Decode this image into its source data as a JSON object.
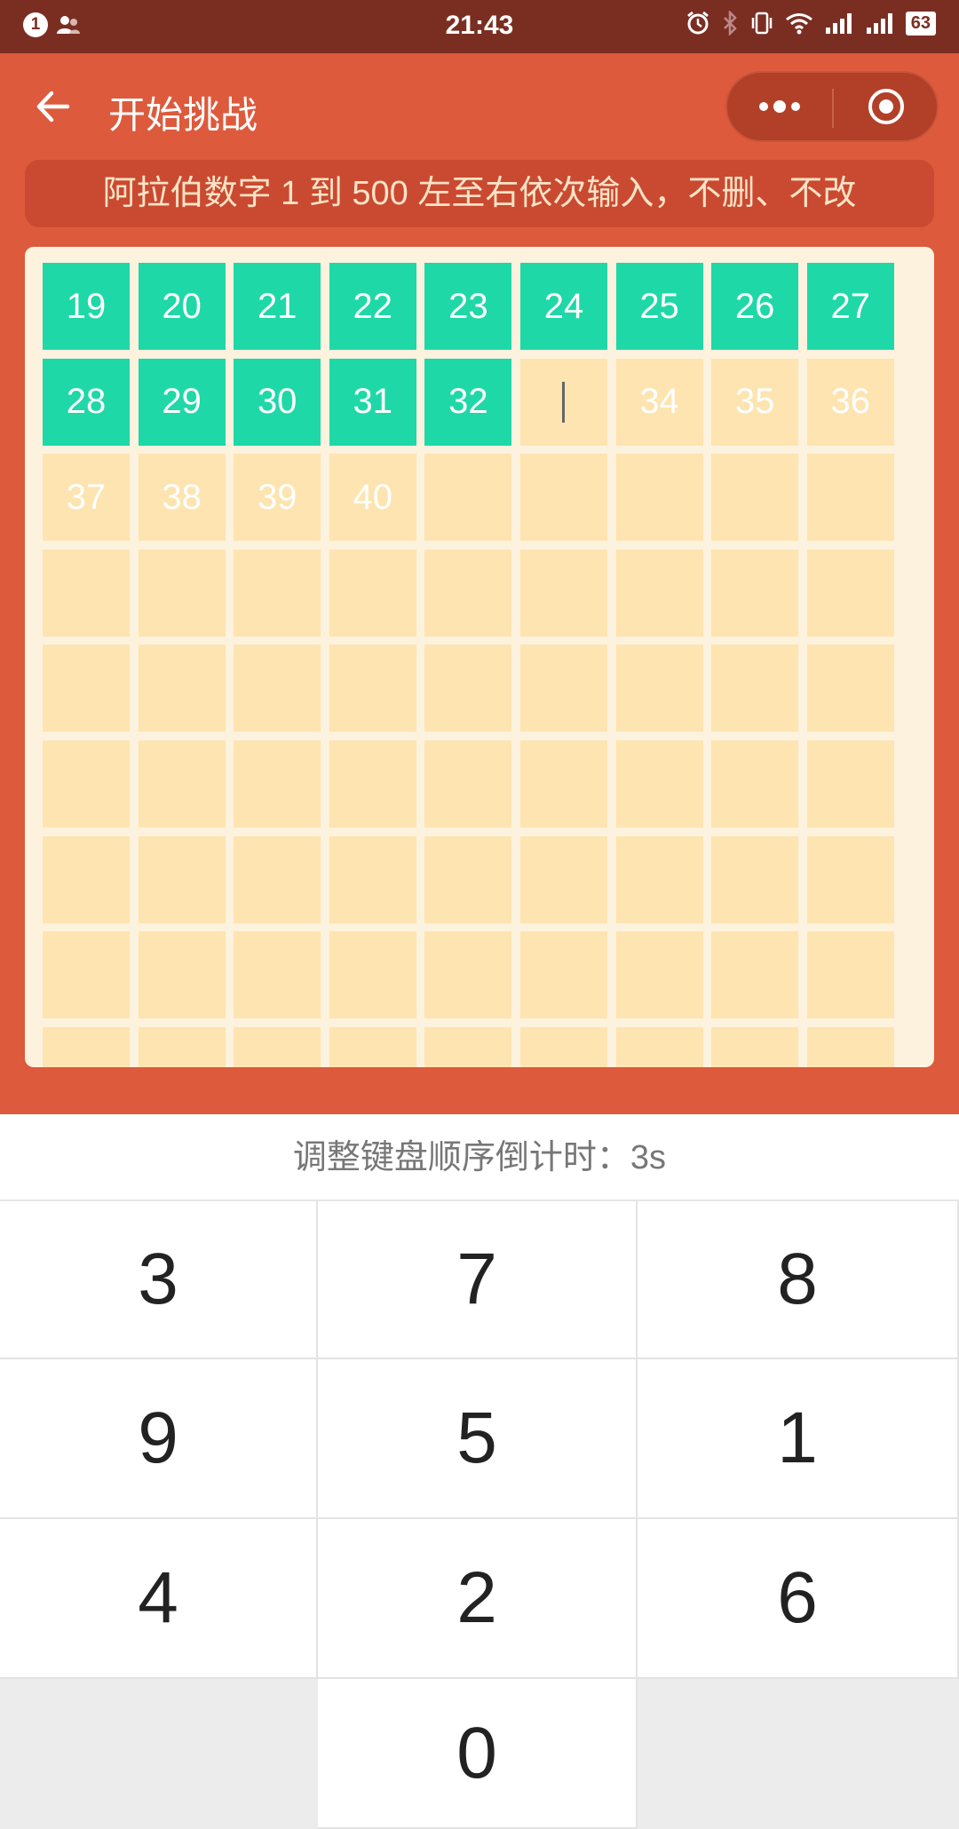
{
  "status_bar": {
    "time": "21:43",
    "notification_count": "1",
    "battery": "63"
  },
  "header": {
    "title": "开始挑战"
  },
  "banner": {
    "text": "阿拉伯数字 1 到 500 左至右依次输入，不删、不改"
  },
  "board": {
    "completed": [
      "19",
      "20",
      "21",
      "22",
      "23",
      "24",
      "25",
      "26",
      "27",
      "28",
      "29",
      "30",
      "31",
      "32"
    ],
    "upcoming": [
      "34",
      "35",
      "36",
      "37",
      "38",
      "39",
      "40"
    ]
  },
  "countdown": {
    "text": "调整键盘顺序倒计时：3s"
  },
  "keypad": {
    "keys": [
      "3",
      "7",
      "8",
      "9",
      "5",
      "1",
      "4",
      "2",
      "6",
      "0"
    ]
  },
  "colors": {
    "status_bar": "#7a2e22",
    "header": "#dd5a3c",
    "completed_cell": "#1fd8a7",
    "empty_cell": "#fde4b0",
    "board_bg": "#fdf2de"
  }
}
